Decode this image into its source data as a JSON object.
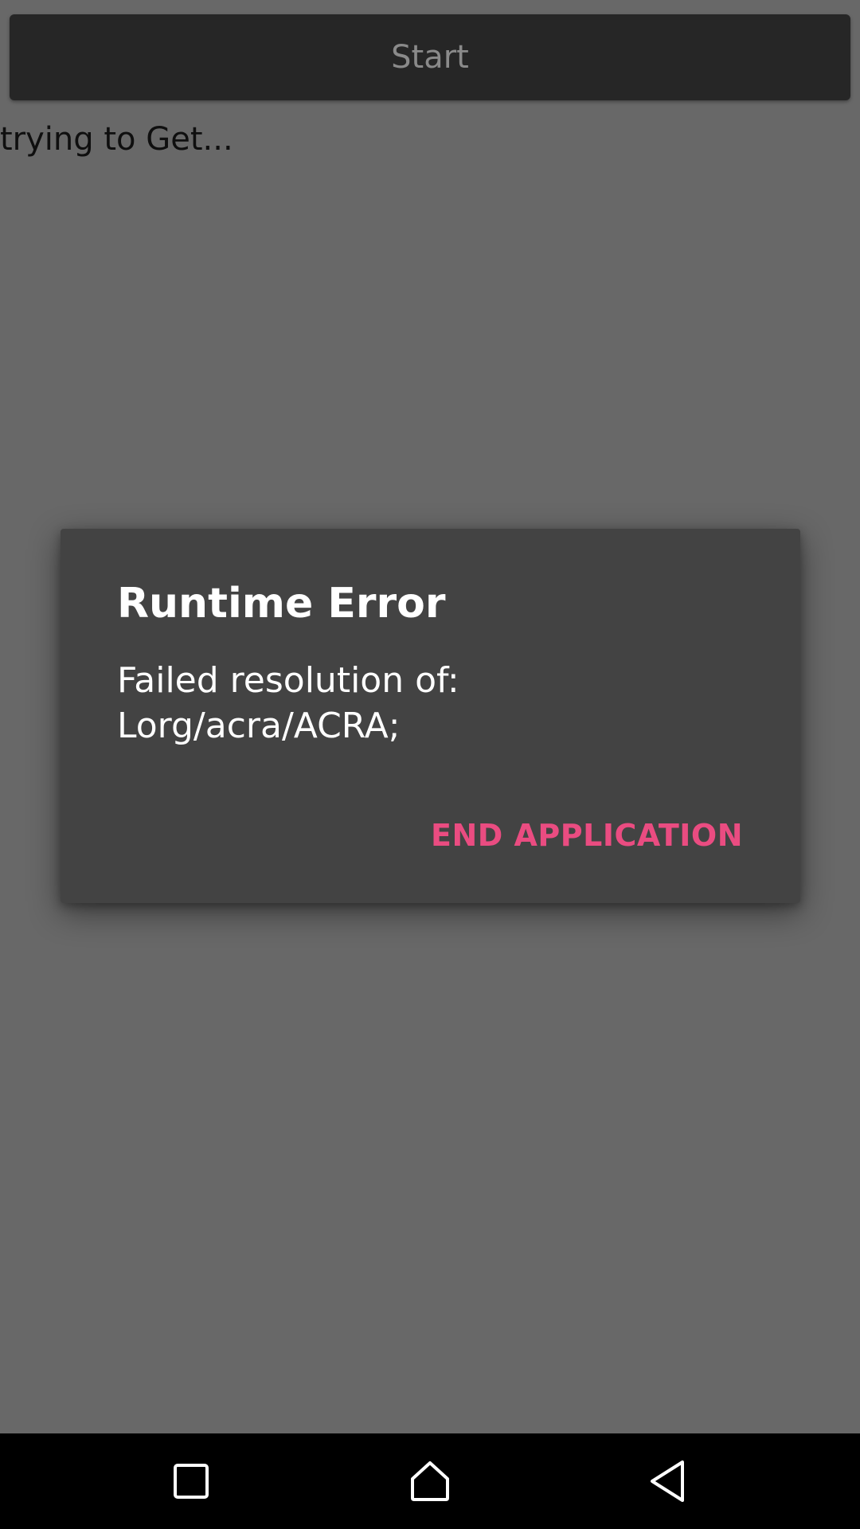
{
  "app": {
    "start_label": "Start",
    "status": "trying to Get..."
  },
  "dialog": {
    "title": "Runtime Error",
    "message": "Failed resolution of: Lorg/acra/ACRA;",
    "action_label": "END APPLICATION",
    "action_color": "#ea4c81"
  },
  "nav": {
    "icons": [
      "recents-icon",
      "home-icon",
      "back-icon"
    ]
  }
}
